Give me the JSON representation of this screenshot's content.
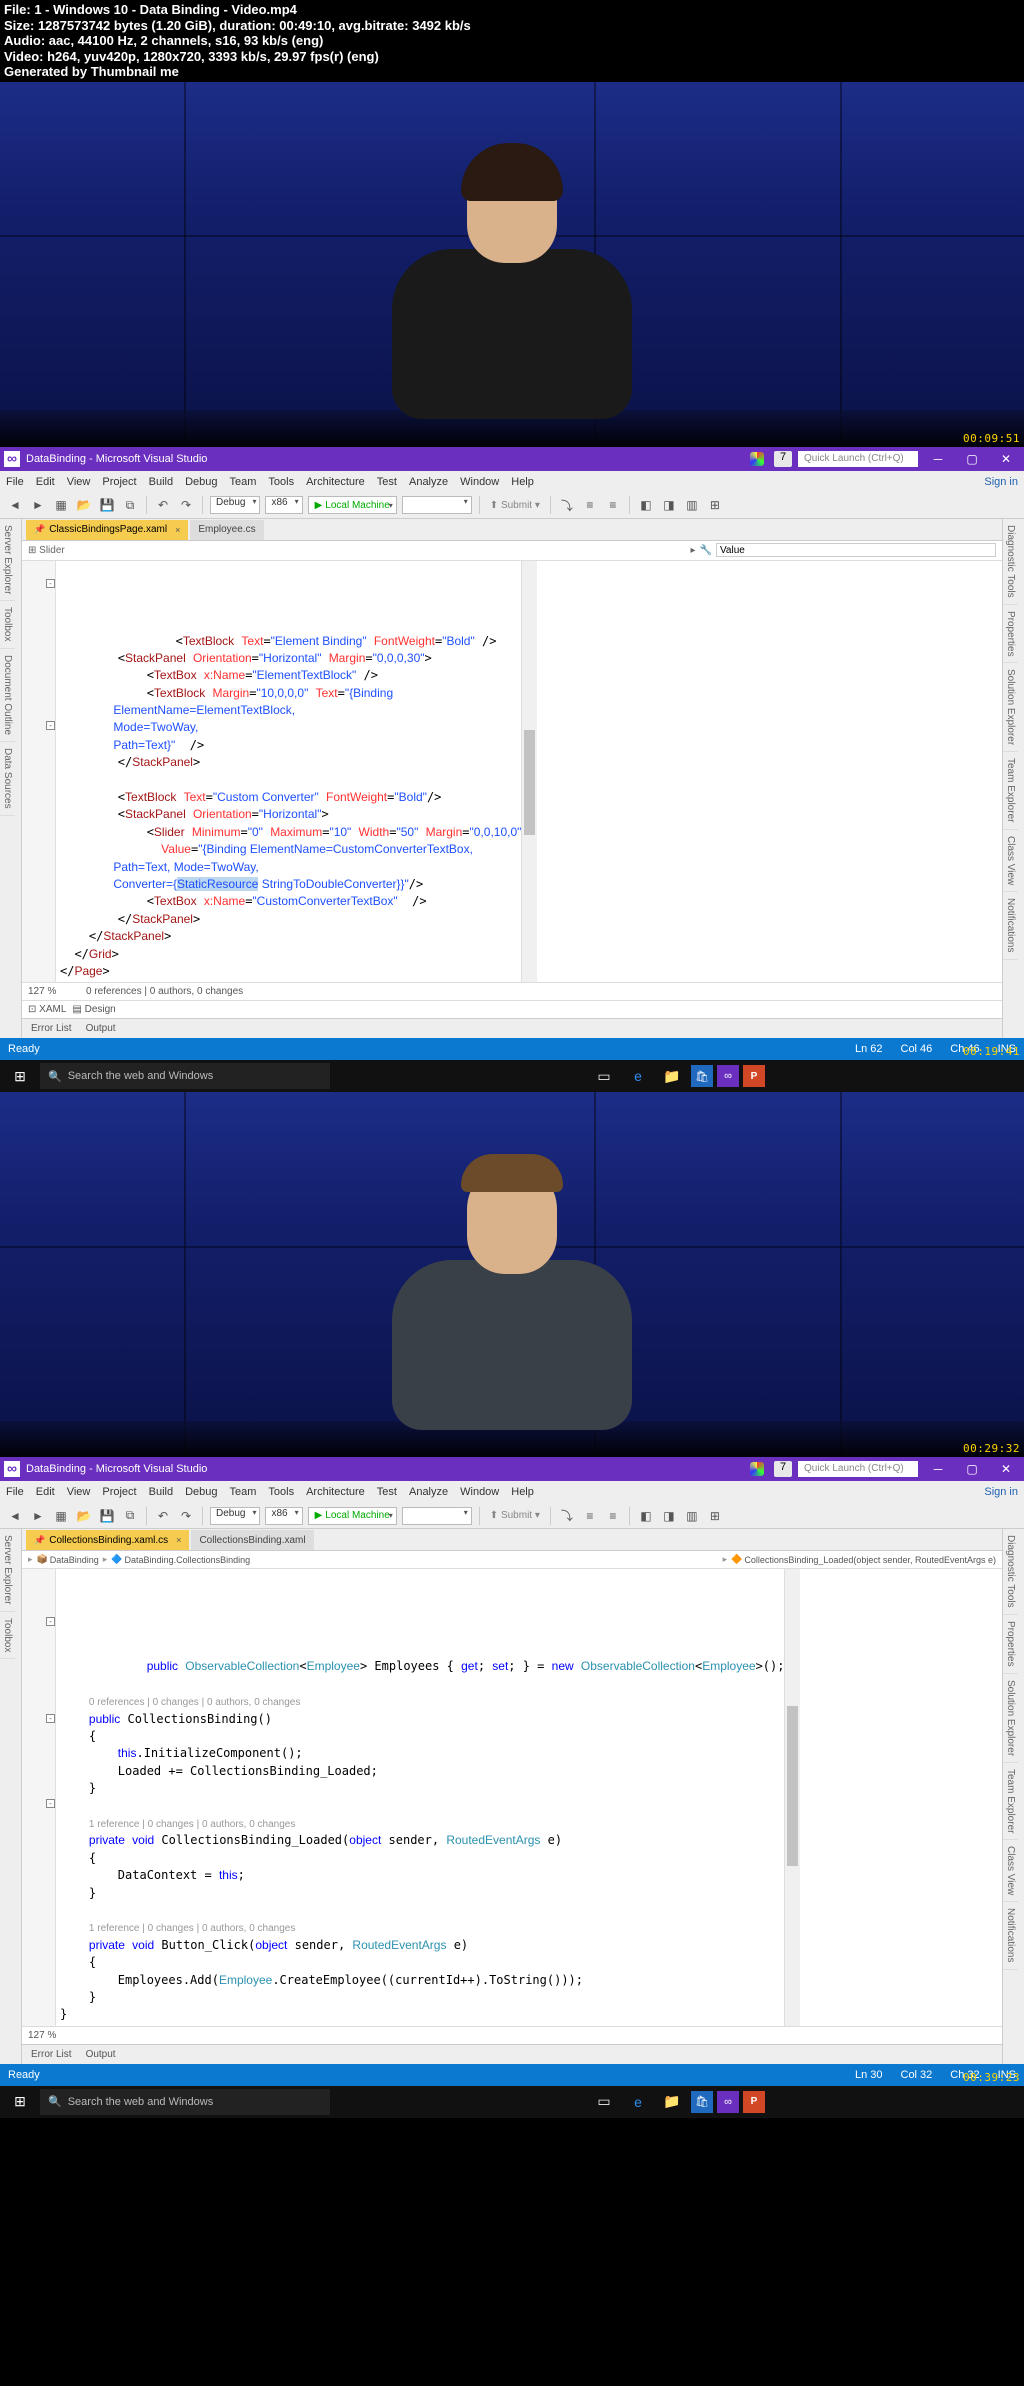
{
  "meta": {
    "file": "File: 1 - Windows 10 - Data Binding - Video.mp4",
    "size": "Size: 1287573742 bytes (1.20 GiB), duration: 00:49:10, avg.bitrate: 3492 kb/s",
    "audio": "Audio: aac, 44100 Hz, 2 channels, s16, 93 kb/s (eng)",
    "video": "Video: h264, yuv420p, 1280x720, 3393 kb/s, 29.97 fps(r) (eng)",
    "gen": "Generated by Thumbnail me"
  },
  "timestamps": {
    "ts1": "00:09:51",
    "ts2": "00:19:41",
    "ts3": "00:29:32",
    "ts4": "00:39:23"
  },
  "vs": {
    "title_app": "DataBinding - Microsoft Visual Studio",
    "quicklaunch": "Quick Launch (Ctrl+Q)",
    "survey": "7",
    "menu": [
      "File",
      "Edit",
      "View",
      "Project",
      "Build",
      "Debug",
      "Team",
      "Tools",
      "Architecture",
      "Test",
      "Analyze",
      "Window",
      "Help"
    ],
    "signin": "Sign in",
    "toolbar": {
      "config": "Debug",
      "platform": "x86",
      "run": "Local Machine",
      "submit": "Submit"
    },
    "leftRails": [
      "Server Explorer",
      "Toolbox",
      "Document Outline",
      "Data Sources"
    ],
    "rightRails": [
      "Diagnostic Tools",
      "Properties",
      "Solution Explorer",
      "Team Explorer",
      "Class View",
      "Notifications"
    ]
  },
  "vs1": {
    "tabs": [
      {
        "label": "ClassicBindingsPage.xaml",
        "active": true,
        "pin": true
      },
      {
        "label": "Employee.cs",
        "active": false
      }
    ],
    "subtoolbar_left": "⊞ Slider",
    "subtoolbar_value": "Value",
    "code_html": "        &lt;<span class='tk-tag'>TextBlock</span> <span class='tk-attr'>Text</span>=<span class='tk-str'>\"Element Binding\"</span> <span class='tk-attr'>FontWeight</span>=<span class='tk-str'>\"Bold\"</span> /&gt;\n        &lt;<span class='tk-tag'>StackPanel</span> <span class='tk-attr'>Orientation</span>=<span class='tk-str'>\"Horizontal\"</span> <span class='tk-attr'>Margin</span>=<span class='tk-str'>\"0,0,0,30\"</span>&gt;\n            &lt;<span class='tk-tag'>TextBox</span> <span class='tk-attr'>x:Name</span>=<span class='tk-str'>\"ElementTextBlock\"</span> /&gt;\n            &lt;<span class='tk-tag'>TextBlock</span> <span class='tk-attr'>Margin</span>=<span class='tk-str'>\"10,0,0,0\"</span> <span class='tk-attr'>Text</span>=<span class='tk-str'>\"{Binding \n                ElementName=ElementTextBlock, \n                Mode=TwoWay, \n                Path=Text}\"</span>  /&gt;\n        &lt;/<span class='tk-tag'>StackPanel</span>&gt;\n\n        &lt;<span class='tk-tag'>TextBlock</span> <span class='tk-attr'>Text</span>=<span class='tk-str'>\"Custom Converter\"</span> <span class='tk-attr'>FontWeight</span>=<span class='tk-str'>\"Bold\"</span>/&gt;\n        &lt;<span class='tk-tag'>StackPanel</span> <span class='tk-attr'>Orientation</span>=<span class='tk-str'>\"Horizontal\"</span>&gt;\n            &lt;<span class='tk-tag'>Slider</span> <span class='tk-attr'>Minimum</span>=<span class='tk-str'>\"0\"</span> <span class='tk-attr'>Maximum</span>=<span class='tk-str'>\"10\"</span> <span class='tk-attr'>Width</span>=<span class='tk-str'>\"50\"</span> <span class='tk-attr'>Margin</span>=<span class='tk-str'>\"0,0,10,0\"</span>\n              <span class='tk-attr'>Value</span>=<span class='tk-str'>\"{Binding ElementName=CustomConverterTextBox, \n                Path=Text, Mode=TwoWay, \n                Converter={<span class='tk-hl'>StaticResource</span> StringToDoubleConverter}}\"</span>/&gt;\n            &lt;<span class='tk-tag'>TextBox</span> <span class='tk-attr'>x:Name</span>=<span class='tk-str'>\"CustomConverterTextBox\"</span>  /&gt;\n        &lt;/<span class='tk-tag'>StackPanel</span>&gt;\n    &lt;/<span class='tk-tag'>StackPanel</span>&gt;\n  &lt;/<span class='tk-tag'>Grid</span>&gt;\n&lt;/<span class='tk-tag'>Page</span>&gt;",
    "footer_pct": "127 %",
    "footer_info": "0 references | 0 authors, 0 changes",
    "designtabs": {
      "xaml": "⊡ XAML",
      "design": "▤ Design"
    },
    "bottomtabs": [
      "Error List",
      "Output"
    ],
    "status": {
      "ready": "Ready",
      "ln": "Ln 62",
      "col": "Col 46",
      "ch": "Ch 46",
      "ins": "INS"
    }
  },
  "vs2": {
    "tabs": [
      {
        "label": "CollectionsBinding.xaml.cs",
        "active": true,
        "pin": true
      },
      {
        "label": "CollectionsBinding.xaml",
        "active": false
      }
    ],
    "breadcrumb": {
      "ns": "DataBinding",
      "cls": "DataBinding.CollectionsBinding",
      "member": "CollectionsBinding_Loaded(object sender, RoutedEventArgs e)"
    },
    "code_html": "    <span class='tk-kw'>public</span> <span class='tk-type'>ObservableCollection</span>&lt;<span class='tk-type'>Employee</span>&gt; Employees { <span class='tk-kw'>get</span>; <span class='tk-kw'>set</span>; } = <span class='tk-kw'>new</span> <span class='tk-type'>ObservableCollection</span>&lt;<span class='tk-type'>Employee</span>&gt;();\n\n    <span class='codelens'>0 references | 0 changes | 0 authors, 0 changes</span>\n    <span class='tk-kw'>public</span> CollectionsBinding()\n    {\n        <span class='tk-kw'>this</span>.InitializeComponent();\n        Loaded += CollectionsBinding_Loaded;\n    }\n\n    <span class='codelens'>1 reference | 0 changes | 0 authors, 0 changes</span>\n    <span class='tk-kw'>private</span> <span class='tk-kw'>void</span> CollectionsBinding_Loaded(<span class='tk-kw'>object</span> sender, <span class='tk-type'>RoutedEventArgs</span> e)\n    {\n        DataContext = <span class='tk-kw'>this</span>;\n    }\n\n    <span class='codelens'>1 reference | 0 changes | 0 authors, 0 changes</span>\n    <span class='tk-kw'>private</span> <span class='tk-kw'>void</span> Button_Click(<span class='tk-kw'>object</span> sender, <span class='tk-type'>RoutedEventArgs</span> e)\n    {\n        Employees.Add(<span class='tk-type'>Employee</span>.CreateEmployee((currentId++).ToString()));\n    }\n}\n",
    "footer_pct": "127 %",
    "bottomtabs": [
      "Error List",
      "Output"
    ],
    "status": {
      "ready": "Ready",
      "ln": "Ln 30",
      "col": "Col 32",
      "ch": "Ch 32",
      "ins": "INS"
    }
  },
  "taskbar": {
    "search": "Search the web and Windows"
  }
}
